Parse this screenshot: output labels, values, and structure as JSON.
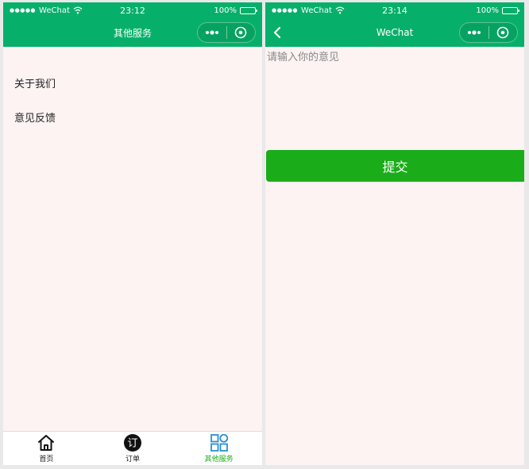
{
  "left_screen": {
    "status_bar": {
      "carrier": "WeChat",
      "time": "23:12",
      "battery": "100%"
    },
    "nav": {
      "title": "其他服务"
    },
    "menu": [
      "关于我们",
      "意见反馈"
    ],
    "tabs": [
      {
        "label": "首页",
        "icon": "home-icon",
        "active": false
      },
      {
        "label": "订单",
        "icon": "order-icon",
        "active": false
      },
      {
        "label": "其他服务",
        "icon": "grid-icon",
        "active": true
      }
    ]
  },
  "right_screen": {
    "status_bar": {
      "carrier": "WeChat",
      "time": "23:14",
      "battery": "100%"
    },
    "nav": {
      "title": "WeChat"
    },
    "feedback": {
      "placeholder": "请输入你的意见",
      "value": ""
    },
    "submit_label": "提交"
  },
  "colors": {
    "nav_green": "#07b06a",
    "button_green": "#1aad19",
    "page_background": "#fdf3f3"
  }
}
